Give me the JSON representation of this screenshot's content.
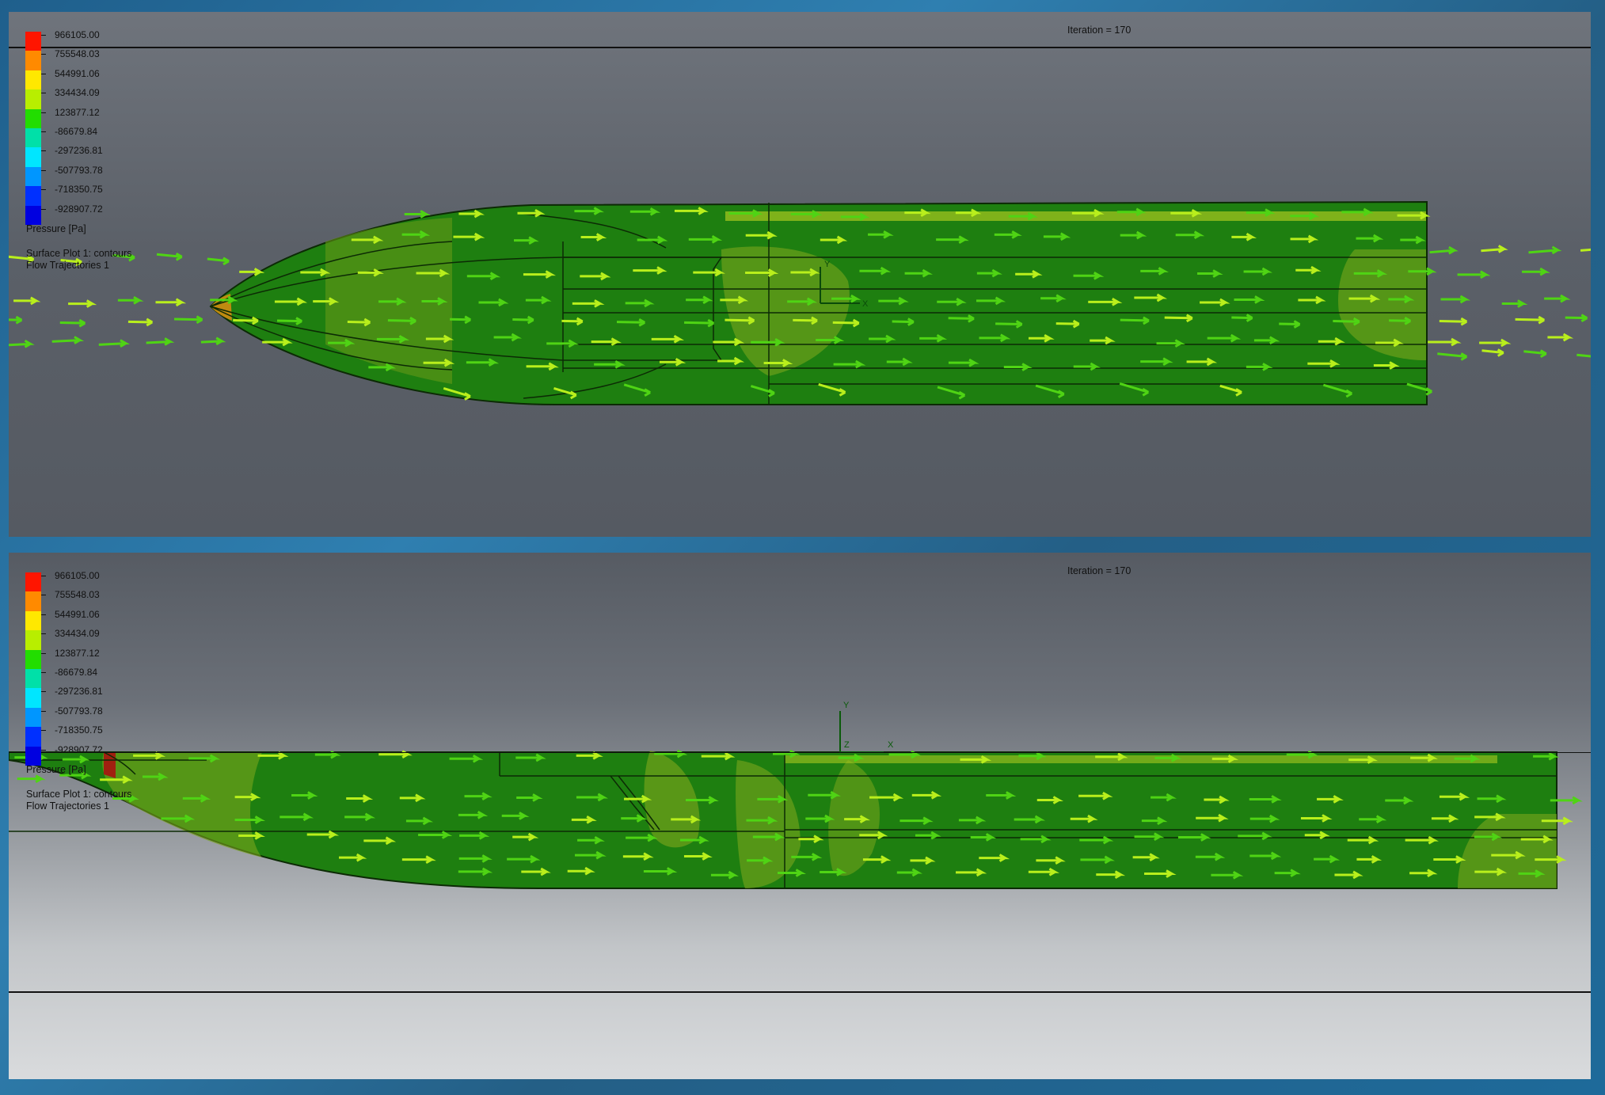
{
  "panels": [
    {
      "iteration_label": "Iteration = 170",
      "legend": {
        "values": [
          "966105.00",
          "755548.03",
          "544991.06",
          "334434.09",
          "123877.12",
          "-86679.84",
          "-297236.81",
          "-507793.78",
          "-718350.75",
          "-928907.72"
        ],
        "title": "Pressure [Pa]",
        "plot_label": "Surface Plot 1: contours",
        "traj_label": "Flow Trajectories 1"
      },
      "axes": {
        "y": "Y",
        "x": "X"
      }
    },
    {
      "iteration_label": "Iteration = 170",
      "legend": {
        "values": [
          "966105.00",
          "755548.03",
          "544991.06",
          "334434.09",
          "123877.12",
          "-86679.84",
          "-297236.81",
          "-507793.78",
          "-718350.75",
          "-928907.72"
        ],
        "title": "Pressure [Pa]",
        "plot_label": "Surface Plot 1: contours",
        "traj_label": "Flow Trajectories 1"
      },
      "axes": {
        "y": "Y",
        "z": "Z",
        "x": "X"
      }
    }
  ],
  "legend_colors": [
    "#ff1500",
    "#ff8a00",
    "#ffe800",
    "#b8ee00",
    "#22dd00",
    "#00e0a8",
    "#00e6ff",
    "#0096ff",
    "#0030ff",
    "#0000e0"
  ]
}
